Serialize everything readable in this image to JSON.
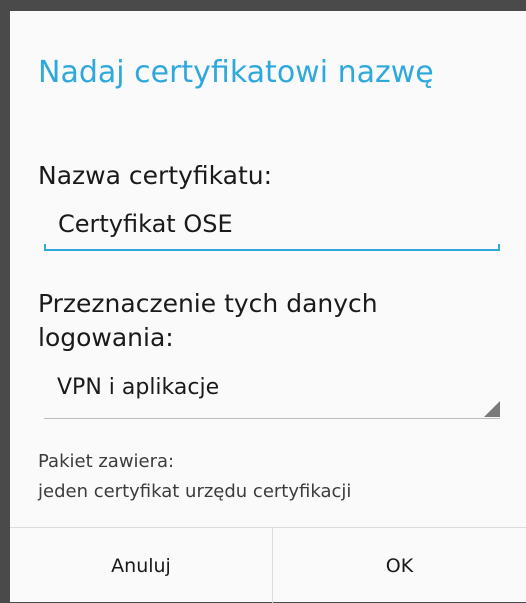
{
  "dialog": {
    "title": "Nadaj certyfikatowi nazwę",
    "name_label": "Nazwa certyfikatu:",
    "name_value": "Certyfikat OSE",
    "purpose_label": "Przeznaczenie tych danych logowania:",
    "purpose_value": "VPN i aplikacje",
    "package_label": "Pakiet zawiera:",
    "package_content": "jeden certyfikat urzędu certyfikacji",
    "cancel_label": "Anuluj",
    "ok_label": "OK"
  },
  "colors": {
    "accent": "#2fa8dc",
    "background": "#fafafa",
    "backdrop": "#4a4a4a"
  }
}
